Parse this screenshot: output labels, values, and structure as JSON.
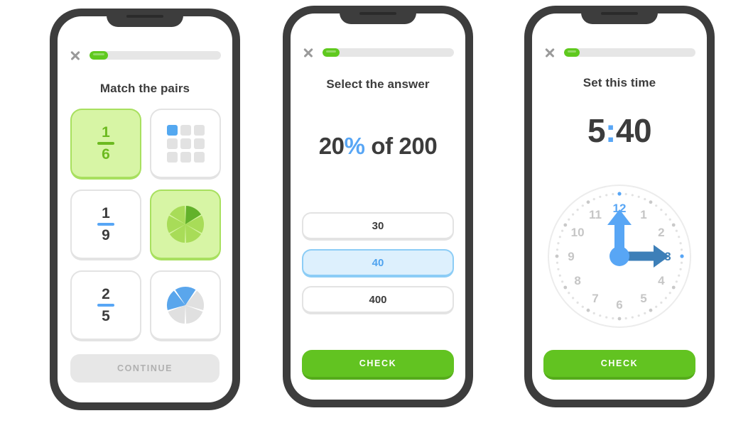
{
  "screens": [
    {
      "id": "match-the-pairs",
      "close_icon": "close-icon",
      "progress_percent": 14,
      "title": "Match the pairs",
      "cards": [
        {
          "type": "fraction",
          "numerator": "1",
          "denominator": "6",
          "selected": true
        },
        {
          "type": "grid",
          "total": 9,
          "filled": 1,
          "selected": false
        },
        {
          "type": "fraction",
          "numerator": "1",
          "denominator": "9",
          "selected": false
        },
        {
          "type": "pie",
          "total": 6,
          "filled": 1,
          "selected": true
        },
        {
          "type": "fraction",
          "numerator": "2",
          "denominator": "5",
          "selected": false
        },
        {
          "type": "pie",
          "total": 5,
          "filled": 2,
          "selected": false
        }
      ],
      "footer_button": {
        "label": "CONTINUE",
        "state": "disabled"
      }
    },
    {
      "id": "select-the-answer",
      "close_icon": "close-icon",
      "progress_percent": 13,
      "title": "Select the answer",
      "equation": {
        "lead": "20",
        "percent": "%",
        "tail": " of 200"
      },
      "options": [
        {
          "label": "30",
          "selected": false
        },
        {
          "label": "40",
          "selected": true
        },
        {
          "label": "400",
          "selected": false
        }
      ],
      "footer_button": {
        "label": "CHECK",
        "state": "enabled"
      }
    },
    {
      "id": "set-this-time",
      "close_icon": "close-icon",
      "progress_percent": 12,
      "title": "Set this time",
      "digital": {
        "hours": "5",
        "colon": ":",
        "minutes": "40"
      },
      "clock": {
        "hour_labels": [
          "12",
          "1",
          "2",
          "3",
          "4",
          "5",
          "6",
          "7",
          "8",
          "9",
          "10",
          "11"
        ],
        "hour_hand_points_to": "3",
        "minute_hand_points_to": "12",
        "highlighted_labels": [
          "12",
          "3"
        ]
      },
      "footer_button": {
        "label": "CHECK",
        "state": "enabled"
      }
    }
  ],
  "colors": {
    "frame": "#3d3d3d",
    "green": "#62c321",
    "green_light": "#d7f5a5",
    "green_text": "#6cba20",
    "blue": "#58a6f5",
    "blue_light": "#ddf0fd",
    "blue_dark": "#3d7fb8",
    "gray_text": "#3c3c3c",
    "gray_border": "#e3e3e3",
    "gray_disabled": "#e7e7e7"
  }
}
